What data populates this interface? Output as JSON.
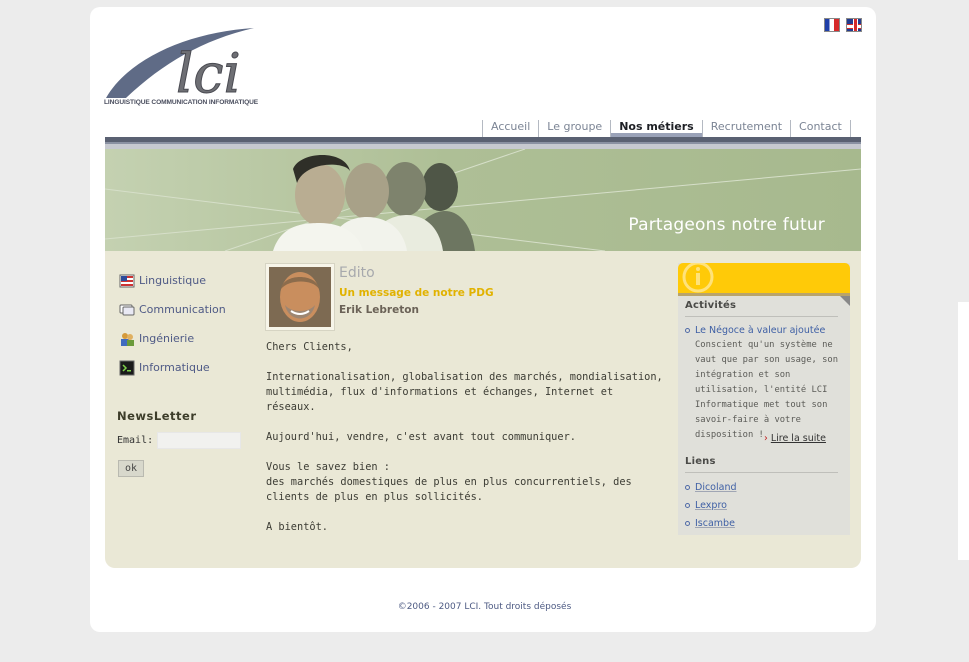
{
  "flags": [
    {
      "name": "francais-flag-icon"
    },
    {
      "name": "english-flag-icon"
    }
  ],
  "logo": {
    "text": "lci",
    "subtitle": "LINGUISTIQUE COMMUNICATION INFORMATIQUE"
  },
  "nav": {
    "items": [
      {
        "label": "Accueil",
        "active": false
      },
      {
        "label": "Le groupe",
        "active": false
      },
      {
        "label": "Nos métiers",
        "active": true
      },
      {
        "label": "Recrutement",
        "active": false
      },
      {
        "label": "Contact",
        "active": false
      }
    ]
  },
  "banner": {
    "tagline": "Partageons notre futur"
  },
  "sidebar": {
    "items": [
      {
        "label": "Linguistique",
        "icon": "flag-doc-icon"
      },
      {
        "label": "Communication",
        "icon": "speech-bubble-icon"
      },
      {
        "label": "Ingénierie",
        "icon": "people-icon"
      },
      {
        "label": "Informatique",
        "icon": "terminal-icon"
      }
    ],
    "newsletter": {
      "title": "NewsLetter",
      "email_label": "Email:",
      "email_value": "",
      "ok_label": "ok"
    }
  },
  "edito": {
    "title": "Edito",
    "subtitle": "Un message de notre PDG",
    "author": "Erik Lebreton",
    "paragraphs": [
      "Chers Clients,",
      "Internationalisation, globalisation des marchés, mondialisation, multimédia, flux d'informations et échanges, Internet et réseaux.",
      "Aujourd'hui, vendre, c'est avant tout communiquer.",
      "Vous le savez bien :\ndes marchés domestiques de plus en plus concurrentiels, des clients de plus en plus sollicités.",
      "A bientôt."
    ]
  },
  "rightbox": {
    "activites": {
      "heading": "Activités",
      "link": "Le Négoce à valeur ajoutée",
      "description": "Conscient qu'un système ne vaut que par son usage, son intégration et son utilisation, l'entité LCI Informatique met tout son savoir-faire à votre disposition !",
      "more": "Lire la suite"
    },
    "liens": {
      "heading": "Liens",
      "links": [
        "Dicoland",
        "Lexpro",
        "Iscambe"
      ]
    }
  },
  "footer": {
    "text": "©2006 - 2007 LCI. Tout droits déposés"
  },
  "colors": {
    "accent_yellow": "#ffca08",
    "nav_dark": "#5a6172",
    "content_bg": "#eae8d6",
    "link_blue": "#3f60a5"
  }
}
